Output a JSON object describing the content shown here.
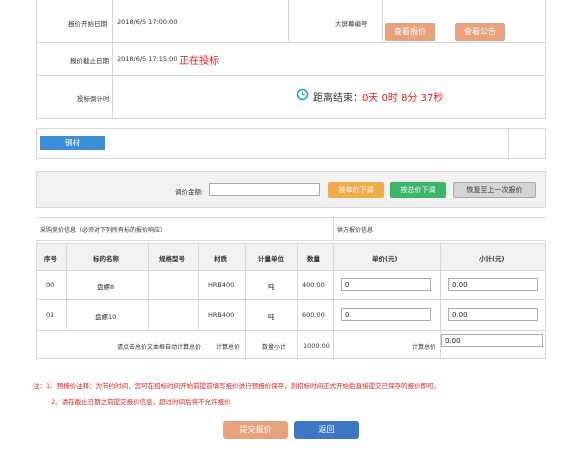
{
  "header": {
    "start_label": "报价开始日期",
    "start_value": "2018/6/5 17:00:00",
    "screen_no_label": "大屏幕编号",
    "view_quote_button": "查看报价",
    "view_notice_button": "查看公告",
    "end_label": "报价截止日期",
    "end_value": "2018/6/5 17:15:00",
    "status": "正在投标",
    "countdown_label": "投标倒计时",
    "countdown_prefix": "距离结束：",
    "countdown_value": "0天 0时 8分 37秒"
  },
  "tab": {
    "label": "钢材"
  },
  "adjust": {
    "label": "调价金额:",
    "input_value": "",
    "by_unit_button": "按单价下调",
    "by_total_button": "按总价下调",
    "restore_button": "恢复至上一次报价"
  },
  "table": {
    "buyer_info": "采购竞价信息（必须对下列所有标的报价响应）",
    "supplier_info": "供方报价信息",
    "headers": [
      "序号",
      "标的名称",
      "规格型号",
      "材质",
      "计量单位",
      "数量",
      "单价(元)",
      "小计(元)"
    ],
    "rows": [
      {
        "no": "00",
        "name": "盘螺8",
        "spec": "",
        "material": "HRB400",
        "unit": "吨",
        "qty": "400.00",
        "price": "0",
        "subtotal": "0.00"
      },
      {
        "no": "01",
        "name": "盘螺10",
        "spec": "",
        "material": "HRB400",
        "unit": "吨",
        "qty": "600.00",
        "price": "0",
        "subtotal": "0.00"
      }
    ],
    "footer_note": "请点击总价文本框自动计算总价",
    "total_label_1": "计算总价",
    "qty_subtotal_label": "数量小计",
    "qty_subtotal_value": "1000.00",
    "total_label_2": "计算总价",
    "total_value": "0.00"
  },
  "notes": {
    "line1": "注：1、预报价注释：为节约时间，您可在招标时间开始前提前填写报价进行预报价保存，到招标时间正式开始后直接提交已保存的报价即可。",
    "line2": "2、请在截止日期之前提交报价信息，超过时间后将不允许报价"
  },
  "actions": {
    "submit_button": "提交报价",
    "back_button": "返回"
  },
  "colors": {
    "orange": "#e7a27d",
    "blue_tab": "#3a8fd6",
    "btn_orange": "#f0ad4e",
    "btn_green": "#3bb56a",
    "btn_gray": "#d4d4d4",
    "back_blue": "#3e78c4",
    "red": "#e02020"
  }
}
